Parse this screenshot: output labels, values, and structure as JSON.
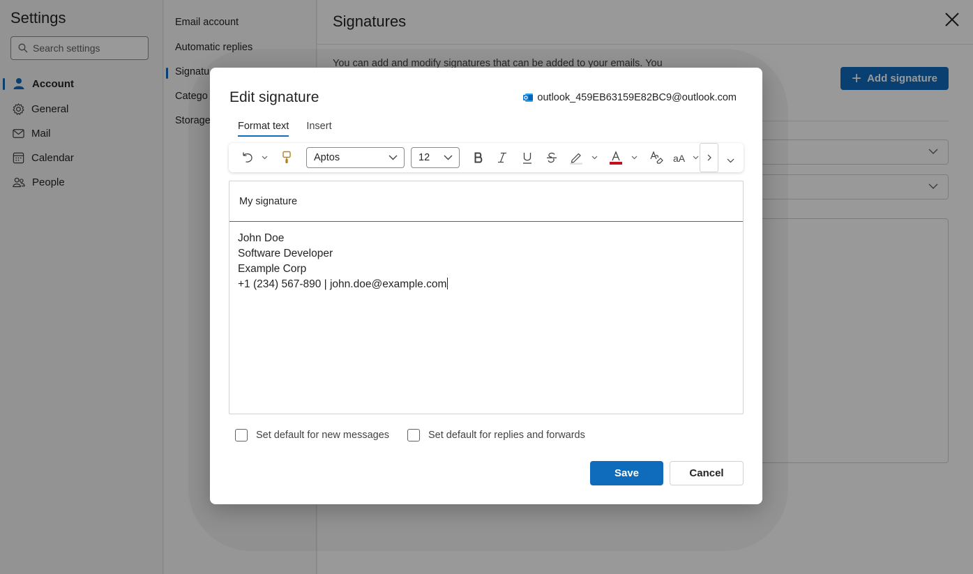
{
  "settings": {
    "title": "Settings",
    "search_placeholder": "Search settings",
    "nav": [
      {
        "label": "Account",
        "icon": "person-icon"
      },
      {
        "label": "General",
        "icon": "gear-icon"
      },
      {
        "label": "Mail",
        "icon": "mail-icon"
      },
      {
        "label": "Calendar",
        "icon": "calendar-icon"
      },
      {
        "label": "People",
        "icon": "people-icon"
      }
    ],
    "subnav": [
      "Email account",
      "Automatic replies",
      "Signatu",
      "Catego",
      "Storage"
    ]
  },
  "main": {
    "title": "Signatures",
    "description": "You can add and modify signatures that can be added to your emails. You",
    "add_signature_label": "Add signature"
  },
  "dialog": {
    "title": "Edit signature",
    "account_email": "outlook_459EB63159E82BC9@outlook.com",
    "tabs": [
      "Format text",
      "Insert"
    ],
    "toolbar": {
      "font": "Aptos",
      "size": "12",
      "text_color": "#c50f1f"
    },
    "signature_name": "My signature",
    "signature_lines": [
      "John Doe",
      "Software Developer",
      "Example Corp",
      "+1 (234) 567-890 | john.doe@example.com"
    ],
    "checkbox_new_messages": "Set default for new messages",
    "checkbox_replies": "Set default for replies and forwards",
    "save_label": "Save",
    "cancel_label": "Cancel"
  },
  "colors": {
    "accent": "#0f6cbd"
  }
}
